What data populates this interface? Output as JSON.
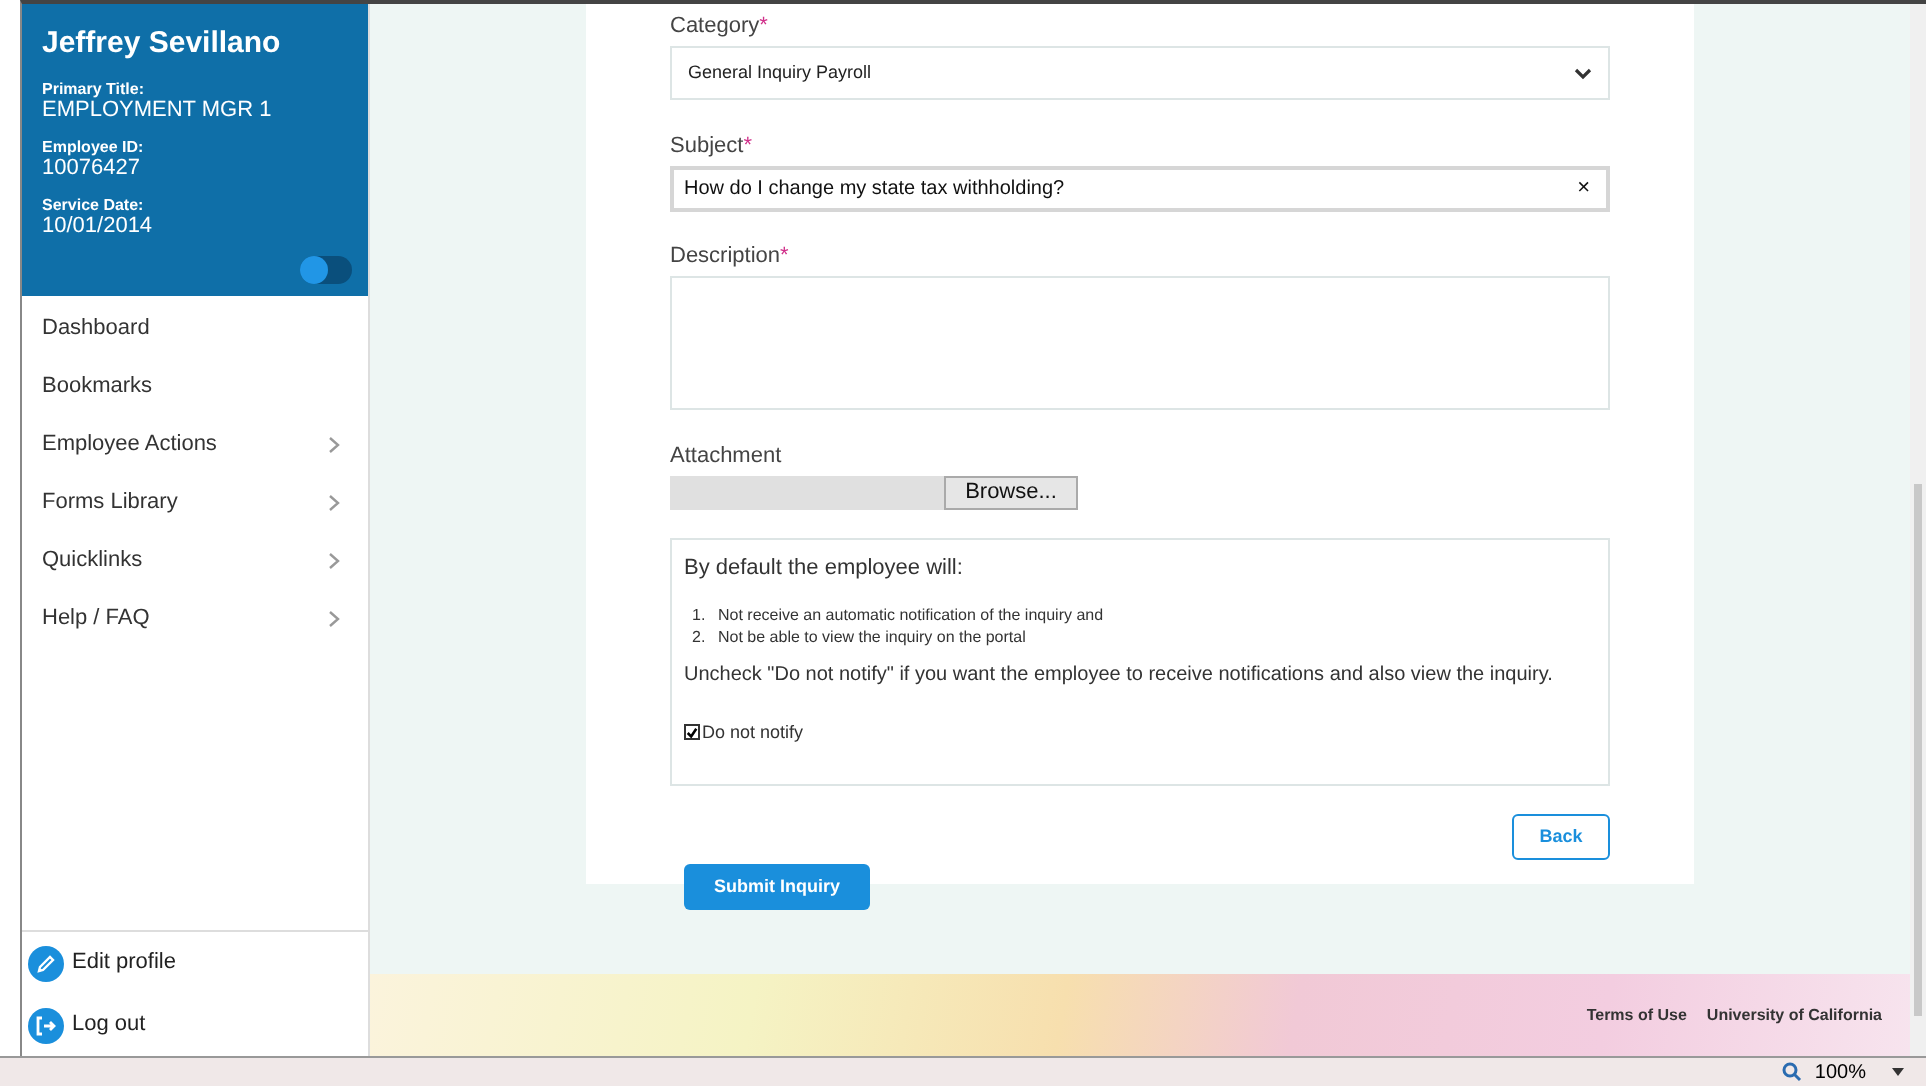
{
  "profile": {
    "name": "Jeffrey Sevillano",
    "fields": [
      {
        "label": "Primary Title:",
        "value": "EMPLOYMENT MGR 1"
      },
      {
        "label": "Employee ID:",
        "value": "10076427"
      },
      {
        "label": "Service Date:",
        "value": "10/01/2014"
      }
    ],
    "toggle_on": false
  },
  "nav": [
    {
      "label": "Dashboard",
      "has_submenu": false
    },
    {
      "label": "Bookmarks",
      "has_submenu": false
    },
    {
      "label": "Employee Actions",
      "has_submenu": true
    },
    {
      "label": "Forms Library",
      "has_submenu": true
    },
    {
      "label": "Quicklinks",
      "has_submenu": true
    },
    {
      "label": "Help / FAQ",
      "has_submenu": true
    }
  ],
  "account_links": [
    {
      "label": "Edit profile",
      "kind": "edit"
    },
    {
      "label": "Log out",
      "kind": "logout"
    }
  ],
  "form": {
    "category": {
      "label": "Category",
      "required_mark": "*",
      "value": "General Inquiry Payroll"
    },
    "subject": {
      "label": "Subject",
      "required_mark": "*",
      "value": "How do I change my state tax withholding?",
      "clear": "×"
    },
    "description": {
      "label": "Description",
      "required_mark": "*"
    },
    "attachment": {
      "label": "Attachment",
      "button": "Browse..."
    },
    "notice": {
      "intro": "By default the employee will:",
      "items": [
        {
          "number": "1.",
          "text": "Not receive an automatic notification of the inquiry and"
        },
        {
          "number": "2.",
          "text": "Not be able to view the inquiry on the portal"
        }
      ],
      "note": "Uncheck \"Do not notify\" if you want the employee to receive notifications and also view the inquiry.",
      "checkbox": {
        "label": "Do not notify",
        "checked": true
      }
    },
    "back_button": "Back",
    "submit_button": "Submit Inquiry"
  },
  "footer_links": [
    "Terms of Use",
    "University of California"
  ],
  "status_bar": {
    "zoom": "100%"
  }
}
